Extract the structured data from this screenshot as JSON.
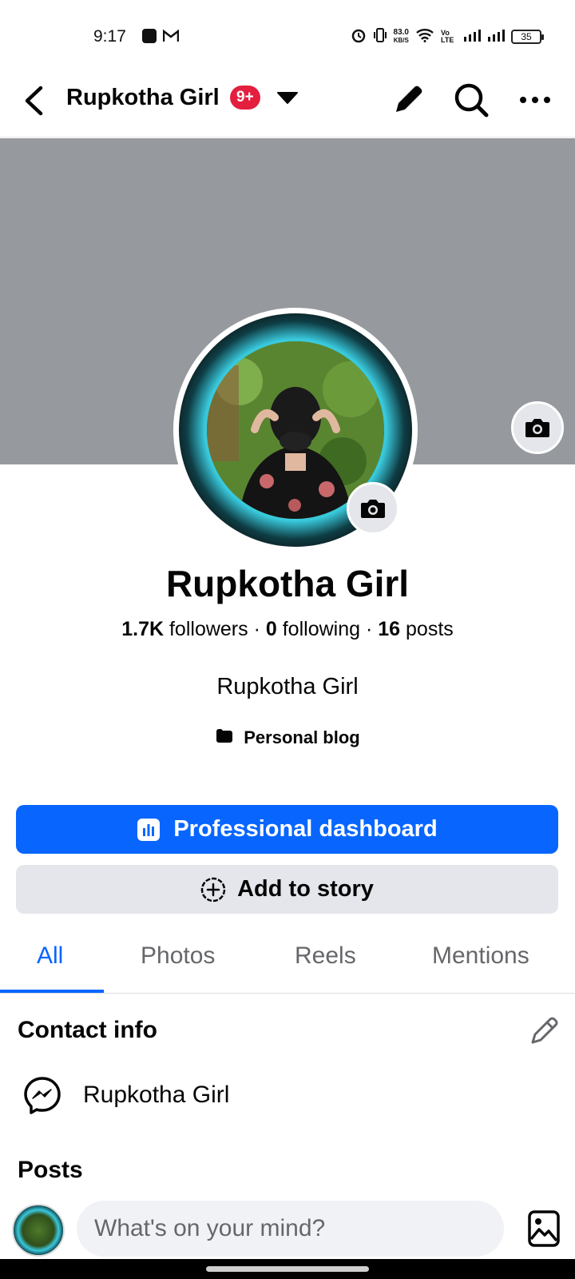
{
  "status_bar": {
    "time": "9:17",
    "net_speed_value": "83.0",
    "net_speed_unit": "KB/S",
    "volte": "Vo LTE",
    "battery": "35"
  },
  "header": {
    "title": "Rupkotha Girl",
    "badge": "9+"
  },
  "profile": {
    "name": "Rupkotha Girl",
    "followers_count": "1.7K",
    "followers_label": "followers",
    "following_count": "0",
    "following_label": "following",
    "posts_count": "16",
    "posts_label": "posts",
    "separator": "·",
    "bio": "Rupkotha Girl",
    "category": "Personal blog"
  },
  "actions": {
    "dashboard_label": "Professional dashboard",
    "story_label": "Add to story"
  },
  "tabs": [
    {
      "label": "All",
      "active": true
    },
    {
      "label": "Photos",
      "active": false
    },
    {
      "label": "Reels",
      "active": false
    },
    {
      "label": "Mentions",
      "active": false
    }
  ],
  "contact": {
    "title": "Contact info",
    "messenger_name": "Rupkotha Girl"
  },
  "posts": {
    "title": "Posts",
    "composer_placeholder": "What's on your mind?"
  },
  "colors": {
    "accent": "#0866ff",
    "badge": "#e41e3f",
    "cover": "#96999e",
    "secondary_button": "#e4e6eb"
  }
}
